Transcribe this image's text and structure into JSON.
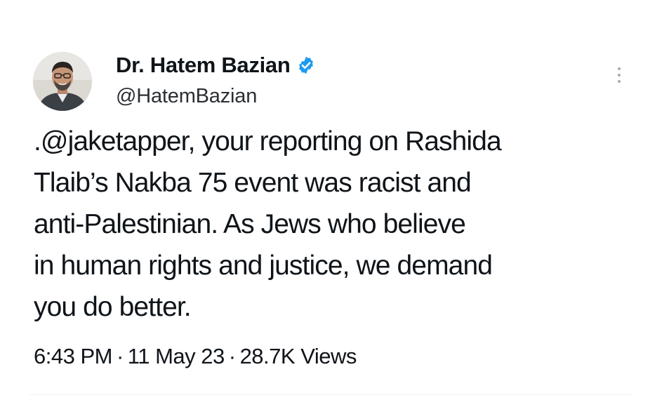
{
  "author": {
    "display_name": "Dr. Hatem Bazian",
    "handle": "@HatemBazian",
    "verified": true,
    "avatar_icon": "profile-photo",
    "verified_icon": "verified-badge-icon",
    "verified_color": "#1d9bf0"
  },
  "tweet": {
    "text": ".@jaketapper, your reporting on Rashida\nTlaib’s Nakba 75 event was racist and\nanti-Palestinian. As Jews who believe\nin human rights and justice, we demand\nyou do better.",
    "time": "6:43 PM",
    "date": "11 May 23",
    "views_count": "28.7K",
    "views_label": "Views",
    "separator": "·"
  },
  "menu": {
    "icon": "more-options-icon"
  }
}
